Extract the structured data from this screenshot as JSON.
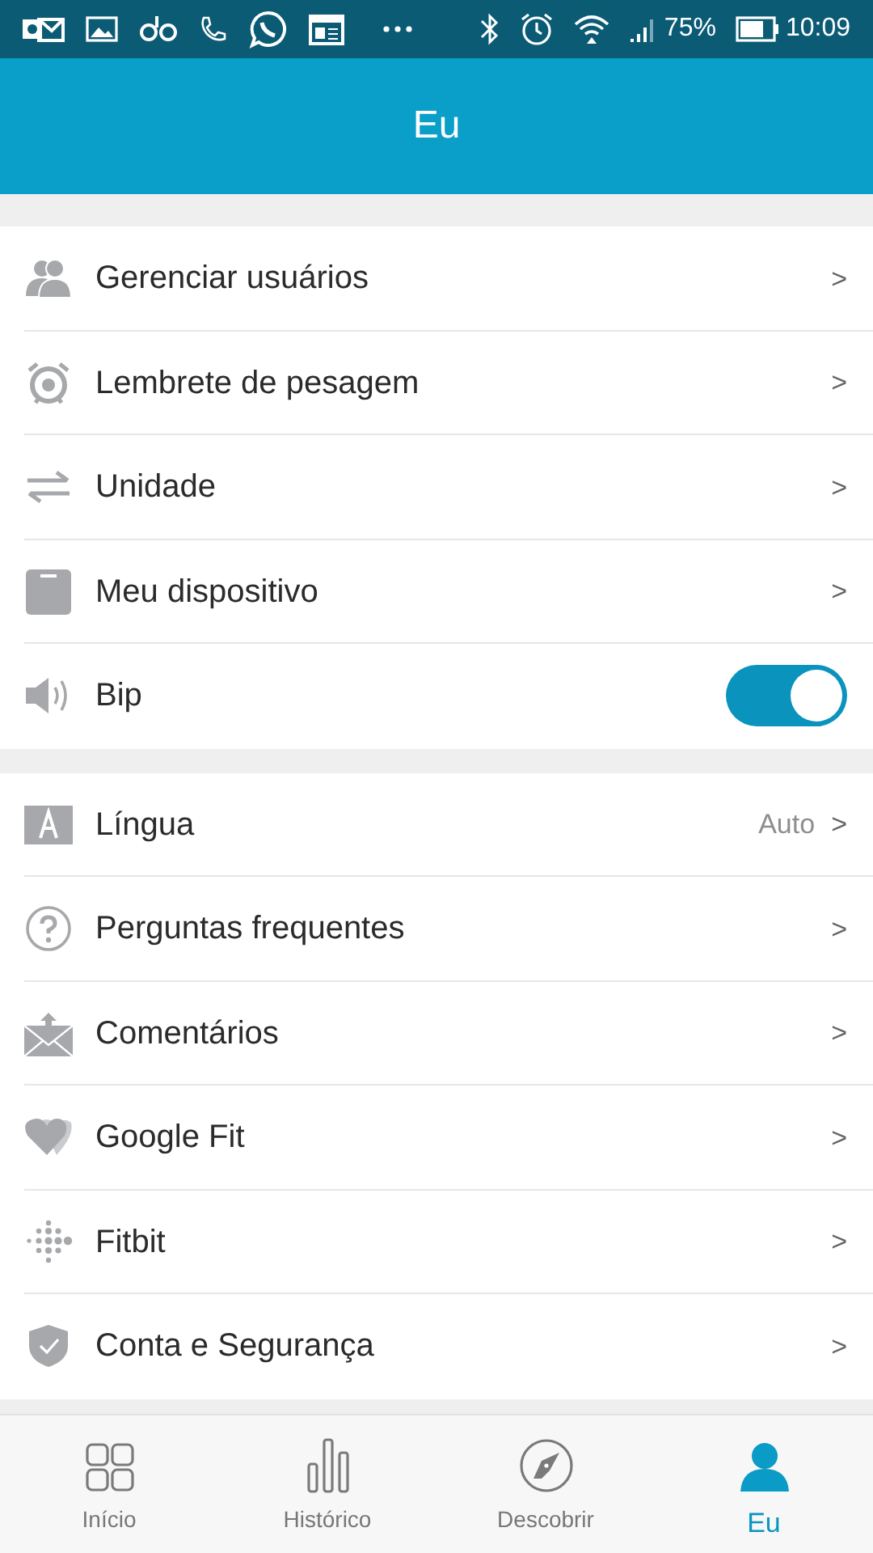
{
  "status_bar": {
    "battery": "75%",
    "time": "10:09"
  },
  "header": {
    "title": "Eu"
  },
  "sections": [
    {
      "items": [
        {
          "kind": "link",
          "label": "Gerenciar usuários",
          "chevron": ">"
        },
        {
          "kind": "link",
          "label": "Lembrete de pesagem",
          "chevron": ">"
        },
        {
          "kind": "link",
          "label": "Unidade",
          "chevron": ">"
        },
        {
          "kind": "link",
          "label": "Meu dispositivo",
          "chevron": ">"
        },
        {
          "kind": "toggle",
          "label": "Bip",
          "on": true
        }
      ]
    },
    {
      "items": [
        {
          "kind": "link",
          "label": "Língua",
          "value": "Auto",
          "chevron": ">"
        },
        {
          "kind": "link",
          "label": "Perguntas frequentes",
          "chevron": ">"
        },
        {
          "kind": "link",
          "label": "Comentários",
          "chevron": ">"
        },
        {
          "kind": "link",
          "label": "Google Fit",
          "chevron": ">"
        },
        {
          "kind": "link",
          "label": "Fitbit",
          "chevron": ">"
        },
        {
          "kind": "link",
          "label": "Conta e Segurança",
          "chevron": ">"
        }
      ]
    }
  ],
  "tabs": [
    {
      "label": "Início",
      "selected": false
    },
    {
      "label": "Histórico",
      "selected": false
    },
    {
      "label": "Descobrir",
      "selected": false
    },
    {
      "label": "Eu",
      "selected": true
    }
  ]
}
